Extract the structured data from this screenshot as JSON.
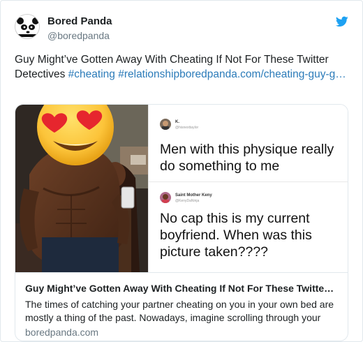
{
  "account": {
    "name": "Bored Panda",
    "handle": "@boredpanda",
    "avatar_icon": "panda-logo-icon",
    "platform_icon": "twitter-bird-icon"
  },
  "tweet": {
    "text_plain": "Guy Might’ve Gotten Away With Cheating If Not For These Twitter Detectives ",
    "hashtag_1": "#cheating",
    "hashtag_2": "#relationship",
    "url_text": "boredpanda.com/cheating-guy-g…"
  },
  "card": {
    "embedded_tweet_1": {
      "name": "K.",
      "handle": "@hisnexttaylor",
      "text": "Men with this physique really do something to me"
    },
    "embedded_tweet_2": {
      "name": "Saint Mother Keny",
      "handle": "@KenyDaNinja",
      "text": "No cap this is my current boyfriend. When was this picture taken????"
    },
    "title": "Guy Might’ve Gotten Away With Cheating If Not For These Twitte…",
    "description": "The times of catching your partner cheating on you in your own bed are mostly a thing of the past. Nowadays, imagine scrolling through your",
    "domain": "boredpanda.com"
  },
  "colors": {
    "link": "#2b7bb9",
    "twitter_blue": "#1da1f2",
    "muted": "#697882",
    "border": "#e1e8ed"
  }
}
